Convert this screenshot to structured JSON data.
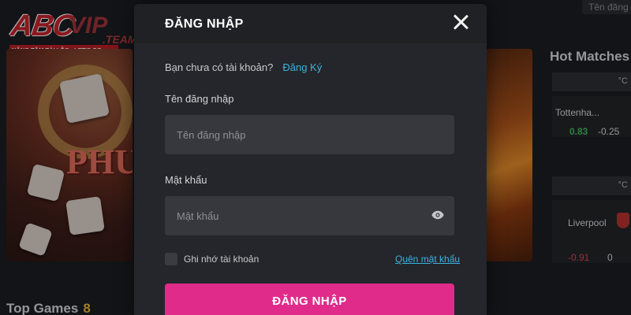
{
  "background": {
    "header_search_placeholder": "Tên đăng",
    "logo": {
      "brand_main": "ABC",
      "brand_vip": "VIP",
      "brand_suffix": ".TEAM",
      "tagline": "NÂNG TẦM TÀI LỘC - LET'S GO"
    },
    "banner_text": "PHU",
    "hot_matches": {
      "title": "Hot Matches",
      "bar_label": "°C",
      "matches": [
        {
          "team": "Tottenha...",
          "odd_1": "0.83",
          "odd_2": "-0.25"
        },
        {
          "team": "Liverpool",
          "odd_1": "-0.91",
          "odd_2": "0"
        }
      ]
    },
    "top_games": {
      "label": "Top Games",
      "count": "8"
    }
  },
  "modal": {
    "title": "ĐĂNG NHẬP",
    "signup_prompt": "Bạn chưa có tài khoản?",
    "signup_link": "Đăng Ký",
    "username": {
      "label": "Tên đăng nhập",
      "placeholder": "Tên đăng nhập",
      "value": ""
    },
    "password": {
      "label": "Mật khẩu",
      "placeholder": "Mật khẩu",
      "value": ""
    },
    "remember_label": "Ghi nhớ tài khoản",
    "remember_checked": false,
    "forgot_link": "Quên mật khẩu",
    "submit_label": "ĐĂNG NHẬP"
  },
  "icons": {
    "close": "close-icon",
    "eye": "eye-icon"
  },
  "colors": {
    "accent": "#e02b8a",
    "link": "#3db2e0",
    "positive": "#3dbb5b",
    "negative": "#e0455a"
  }
}
